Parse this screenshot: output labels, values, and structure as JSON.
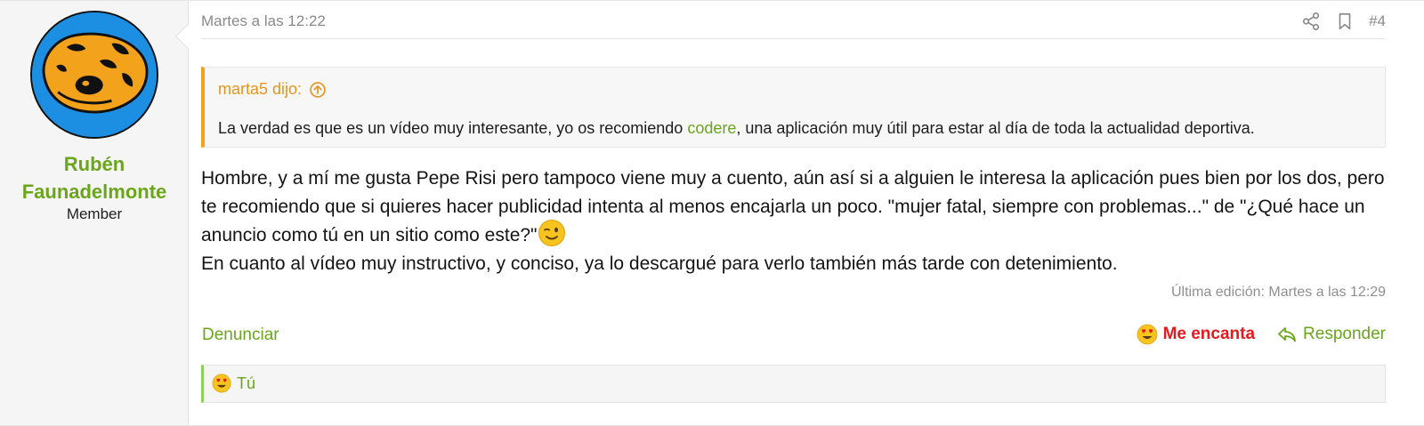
{
  "user": {
    "name_line1": "Rubén",
    "name_line2": "Faunadelmonte",
    "title": "Member"
  },
  "post": {
    "date": "Martes a las 12:22",
    "number": "#4",
    "header_icons": [
      "share-icon",
      "bookmark-icon"
    ],
    "quote": {
      "author": "marta5 dijo:",
      "text_before": "La verdad es que es un vídeo muy interesante, yo os recomiendo ",
      "link_text": "codere",
      "text_after": ", una aplicación muy útil para estar al día de toda la actualidad deportiva."
    },
    "message": {
      "line1": "Hombre, y a mí me gusta Pepe Risi pero tampoco viene muy a cuento, aún así si a alguien le interesa la aplicación pues bien por los dos, pero te recomiendo que si quieres hacer publicidad intenta al menos encajarla un poco. \"mujer fatal, siempre con problemas...\" de \"¿Qué hace un anuncio como tú en un sitio como este?\"",
      "line2": "En cuanto al vídeo muy instructivo, y conciso, ya lo descargué para verlo también más tarde con detenimiento."
    },
    "last_edit": "Última edición: Martes a las 12:29",
    "actions": {
      "report": "Denunciar",
      "love": "Me encanta",
      "reply": "Responder"
    },
    "reactions": {
      "text": "Tú"
    }
  },
  "colors": {
    "accent_green": "#6aa51a",
    "quote_orange": "#f5a11d",
    "love_red": "#e8181f"
  }
}
